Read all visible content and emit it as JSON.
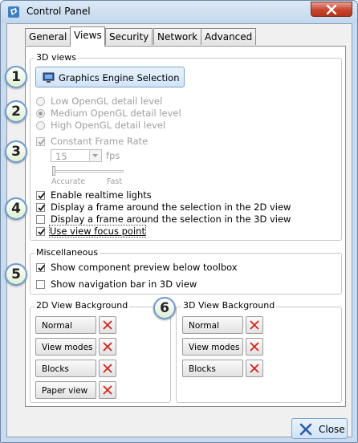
{
  "window": {
    "title": "Control Panel",
    "close_icon": "close-x-icon",
    "accent": "#c8452f"
  },
  "tabs": [
    {
      "label": "General",
      "active": false
    },
    {
      "label": "Views",
      "active": true
    },
    {
      "label": "Security",
      "active": false
    },
    {
      "label": "Network",
      "active": false
    },
    {
      "label": "Advanced",
      "active": false
    }
  ],
  "views_3d": {
    "group_label": "3D views",
    "engine_button": "Graphics Engine Selection",
    "detail_levels": [
      {
        "label": "Low OpenGL detail level",
        "selected": false
      },
      {
        "label": "Medium OpenGL detail level",
        "selected": true
      },
      {
        "label": "High OpenGL detail level",
        "selected": false
      }
    ],
    "constant_frame_rate": {
      "label": "Constant Frame Rate",
      "checked": true,
      "enabled": false
    },
    "fps_value": "15",
    "fps_unit": "fps",
    "slider_min_label": "Accurate",
    "slider_max_label": "Fast",
    "slider_position": 0,
    "options": [
      {
        "label": "Enable realtime lights",
        "checked": true
      },
      {
        "label": "Display a frame around the selection in the 2D view",
        "checked": true
      },
      {
        "label": "Display a frame around the selection in the 3D view",
        "checked": false
      },
      {
        "label": "Use view focus point",
        "checked": true
      }
    ]
  },
  "misc": {
    "group_label": "Miscellaneous",
    "options": [
      {
        "label": "Show component preview below toolbox",
        "checked": true
      },
      {
        "label": "Show navigation bar in 3D view",
        "checked": false
      }
    ]
  },
  "bg2d": {
    "group_label": "2D View Background",
    "buttons": [
      "Normal",
      "View modes",
      "Blocks",
      "Paper view"
    ]
  },
  "bg3d": {
    "group_label": "3D View Background",
    "buttons": [
      "Normal",
      "View modes",
      "Blocks"
    ]
  },
  "callouts": [
    "1",
    "2",
    "3",
    "4",
    "5",
    "6"
  ],
  "close_button": "Close"
}
